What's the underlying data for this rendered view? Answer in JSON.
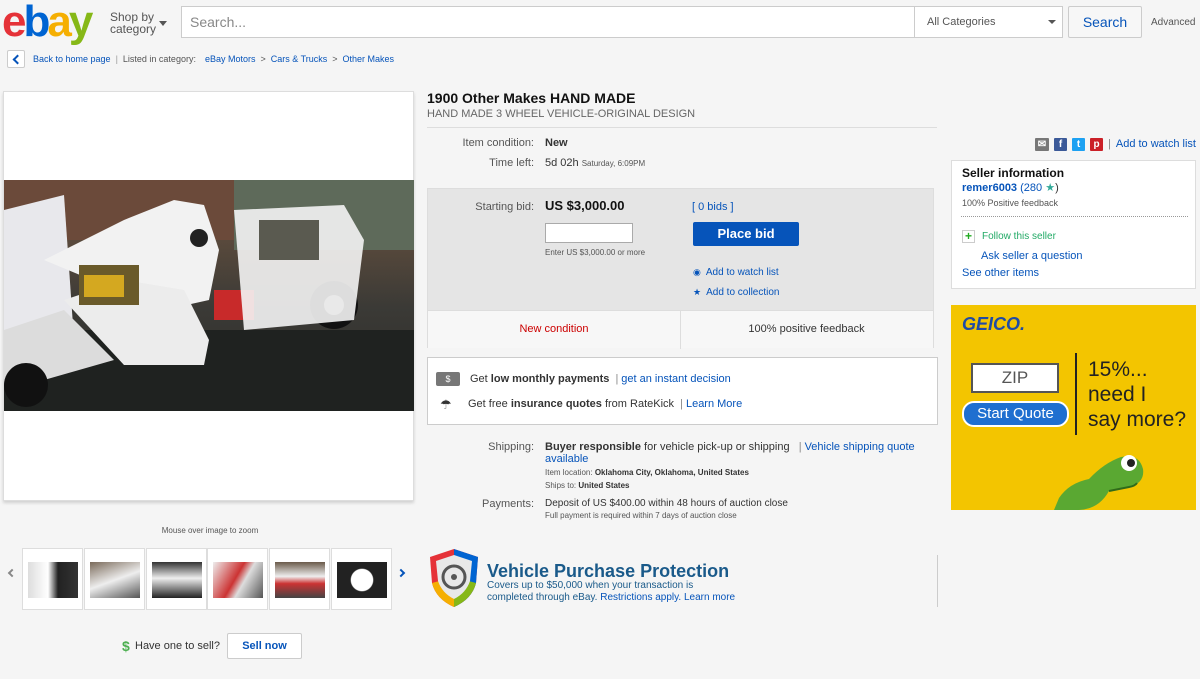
{
  "header": {
    "logo": {
      "e": "e",
      "b": "b",
      "a": "a",
      "y": "y"
    },
    "shop_by": "Shop by",
    "shop_by_2": "category",
    "search_placeholder": "Search...",
    "category": "All Categories",
    "search_button": "Search",
    "advanced": "Advanced"
  },
  "breadcrumb": {
    "back": "Back to home page",
    "listed": "Listed in category:",
    "items": [
      "eBay Motors",
      "Cars & Trucks",
      "Other Makes"
    ],
    "sep": ">"
  },
  "gallery": {
    "zoom_hint": "Mouse over image to zoom",
    "thumbnails": [
      "thumb-1",
      "thumb-2",
      "thumb-3",
      "thumb-4",
      "thumb-5",
      "thumb-6"
    ]
  },
  "sell": {
    "prompt": "Have one to sell?",
    "button": "Sell now",
    "dollar": "$"
  },
  "item": {
    "title": "1900 Other Makes HAND MADE",
    "subtitle": "HAND MADE 3 WHEEL VEHICLE-ORIGINAL DESIGN",
    "condition_label": "Item condition:",
    "condition": "New",
    "time_label": "Time left:",
    "time_left": "5d 02h",
    "time_end": "Saturday, 6:09PM"
  },
  "bid": {
    "label": "Starting bid:",
    "price": "US $3,000.00",
    "bids": "[ 0 bids ]",
    "hint": "Enter US $3,000.00 or more",
    "button": "Place bid",
    "watch": "Add to watch list",
    "collection": "Add to collection",
    "badge_left": "New condition",
    "badge_right": "100% positive feedback"
  },
  "finance": {
    "line1_pre": "Get",
    "line1_bold": "low monthly payments",
    "line1_link": "get an instant decision",
    "line2_pre": "Get free",
    "line2_bold": "insurance quotes",
    "line2_mid": "from RateKick",
    "line2_link": "Learn More",
    "pipe": "|"
  },
  "shipping": {
    "label": "Shipping:",
    "bold": "Buyer responsible",
    "text": "for vehicle pick-up or shipping",
    "link": "Vehicle shipping quote",
    "link2": "available",
    "pipe": "|",
    "location_label": "Item location:",
    "location": "Oklahoma City, Oklahoma, United States",
    "ships_label": "Ships to:",
    "ships": "United States"
  },
  "payments": {
    "label": "Payments:",
    "line1": "Deposit of US $400.00 within 48 hours of auction close",
    "line2": "Full payment is required within 7 days of auction close"
  },
  "vpp": {
    "title": "Vehicle Purchase Protection",
    "line1": "Covers up to $50,000 when your transaction is",
    "line2": "completed through eBay.",
    "restrictions": "Restrictions apply.",
    "learn": "Learn more"
  },
  "share": {
    "watch": "Add to watch list",
    "pipe": "|"
  },
  "seller": {
    "heading": "Seller information",
    "name": "remer6003",
    "score": "(280",
    "star": "★",
    "close": ")",
    "positive": "100% Positive feedback",
    "follow": "Follow this seller",
    "ask": "Ask seller a question",
    "other": "See other items"
  },
  "ad": {
    "brand": "GEICO.",
    "zip": "ZIP",
    "button": "Start Quote",
    "line1": "15%...",
    "line2": "need I",
    "line3": "say more?"
  },
  "colors": {
    "accent": "#0654ba",
    "ad_bg": "#f3c500",
    "condition_red": "#c00"
  }
}
